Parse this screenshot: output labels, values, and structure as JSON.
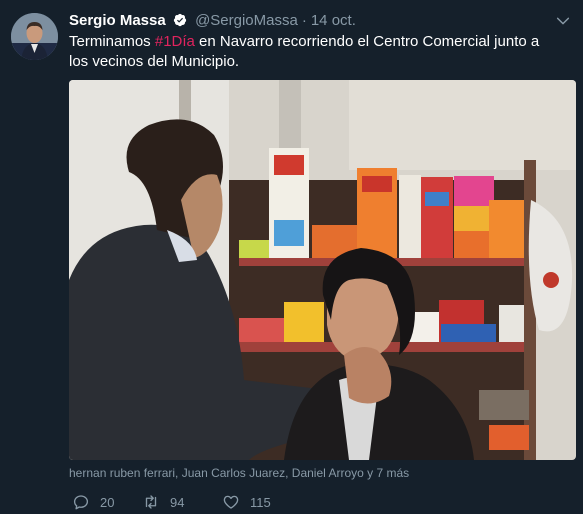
{
  "tweet": {
    "author_name": "Sergio Massa",
    "handle": "@SergioMassa",
    "separator": "·",
    "date": "14 oct.",
    "text_before": "Terminamos ",
    "hashtag": "#1Día",
    "text_after": " en Navarro recorriendo el Centro Comercial junto a los vecinos del Municipio."
  },
  "likers": "hernan ruben ferrari, Juan Carlos Juarez, Daniel Arroyo y 7 más",
  "actions": {
    "replies": "20",
    "retweets": "94",
    "likes": "115"
  },
  "icons": {
    "avatar": "profile-photo",
    "verified": "verified-badge-icon",
    "more": "chevron-down-icon",
    "reply": "reply-icon",
    "retweet": "retweet-icon",
    "like": "heart-icon"
  },
  "colors": {
    "background": "#15202b",
    "secondary_text": "#8899a6",
    "hashtag": "#e0245e"
  }
}
